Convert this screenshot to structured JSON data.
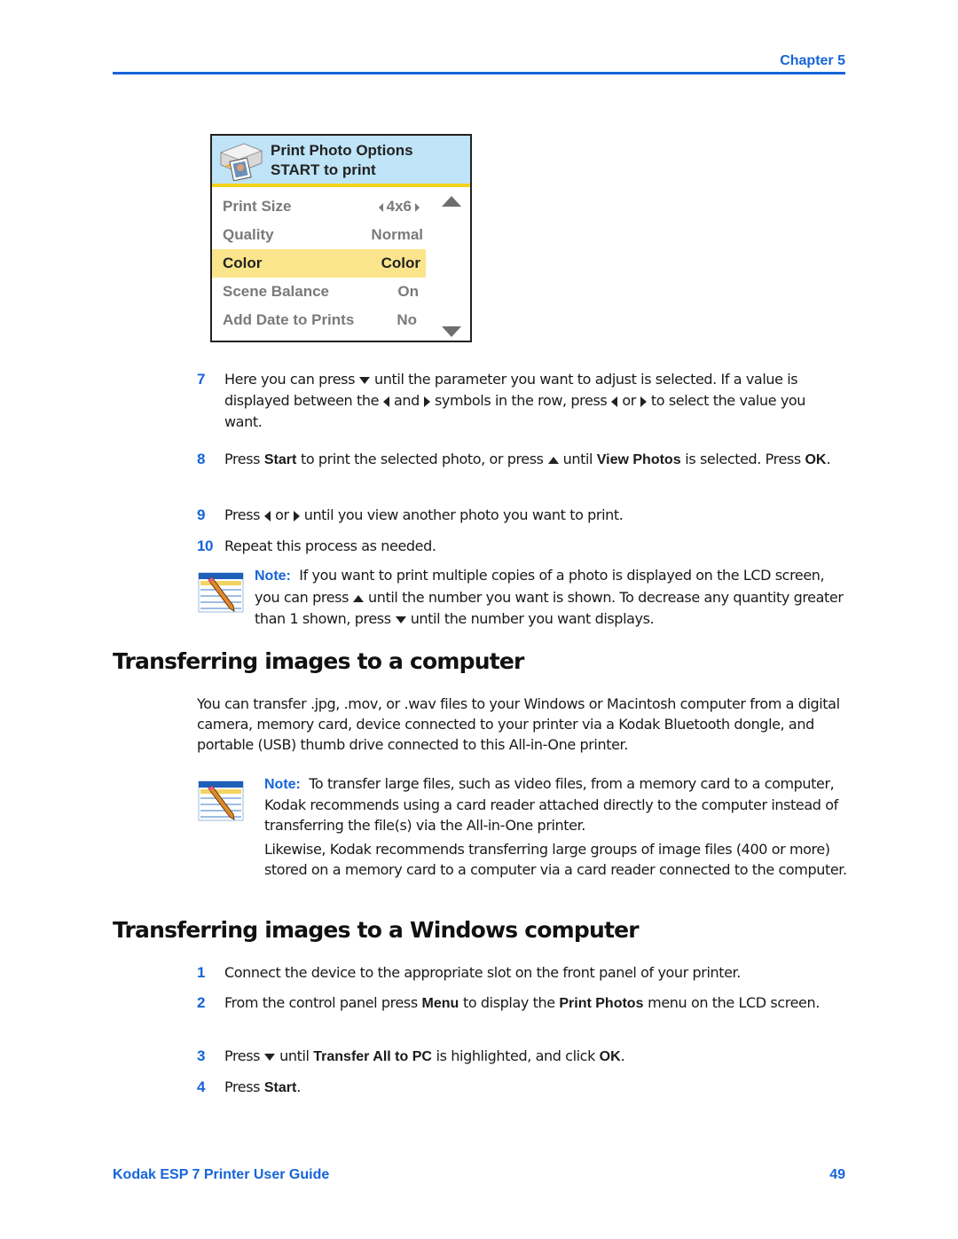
{
  "header": {
    "chapter": "Chapter 5"
  },
  "lcd": {
    "title_line1": "Print Photo Options",
    "title_line2": "START to print",
    "rows": [
      {
        "label": "Print Size",
        "value": "4x6",
        "has_arrows": true
      },
      {
        "label": "Quality",
        "value": "Normal"
      },
      {
        "label": "Color",
        "value": "Color",
        "selected": true
      },
      {
        "label": "Scene Balance",
        "value": "On"
      },
      {
        "label": "Add Date to Prints",
        "value": "No"
      }
    ],
    "icons": {
      "header": "printer-photo-icon",
      "scroll_up": "scroll-up-arrow-icon",
      "scroll_down": "scroll-down-arrow-icon"
    }
  },
  "steps_a": {
    "s7": {
      "num": "7",
      "t1": "Here you can press",
      "t2": "until the parameter you want to adjust is selected. If a value is displayed between the",
      "t3": "and",
      "t4": "symbols in the row, press",
      "t5": "or",
      "t6": "to select the value you want."
    },
    "s8": {
      "num": "8",
      "t1": "Press",
      "b1": "Start",
      "t2": "to print the selected photo, or press",
      "t3": "until",
      "b2": "View Photos",
      "t4": "is selected. Press",
      "b3": "OK",
      "t5": "."
    },
    "s9": {
      "num": "9",
      "t1": "Press",
      "t2": "or",
      "t3": "until you view another photo you want to print."
    },
    "s10": {
      "num": "10",
      "t1": "Repeat this process as needed."
    }
  },
  "note1": {
    "label": "Note:",
    "t1": "If you want to print multiple copies of a photo is displayed on the LCD screen, you can press",
    "t2": "until the number you want is shown. To decrease any quantity greater than 1 shown, press",
    "t3": "until the number you want displays."
  },
  "section1": {
    "heading": "Transferring images to a computer",
    "para": "You can transfer .jpg, .mov, or .wav files to your Windows or Macintosh computer from a digital camera, memory card, device connected to your printer via a Kodak Bluetooth dongle, and portable (USB) thumb drive connected to this All-in-One printer."
  },
  "note2": {
    "label": "Note:",
    "p1": "To transfer large files, such as video files, from a memory card to a computer, Kodak recommends using a card reader attached directly to the computer instead of transferring the file(s) via the All-in-One printer.",
    "p2": "Likewise, Kodak recommends transferring large groups of image files (400 or more) stored on a memory card to a computer via a card reader connected to the computer."
  },
  "section2": {
    "heading": "Transferring images to a Windows computer",
    "s1": {
      "num": "1",
      "t1": "Connect the device to the appropriate slot on the front panel of your printer."
    },
    "s2": {
      "num": "2",
      "t1": "From the control panel press",
      "b1": "Menu",
      "t2": "to display the",
      "b2": "Print Photos",
      "t3": "menu on the LCD screen."
    },
    "s3": {
      "num": "3",
      "t1": "Press",
      "t2": "until",
      "b1": "Transfer All to PC",
      "t3": "is highlighted, and click",
      "b2": "OK",
      "t4": "."
    },
    "s4": {
      "num": "4",
      "t1": "Press",
      "b1": "Start",
      "t2": "."
    }
  },
  "footer": {
    "title": "Kodak ESP 7 Printer User Guide",
    "page": "49"
  }
}
